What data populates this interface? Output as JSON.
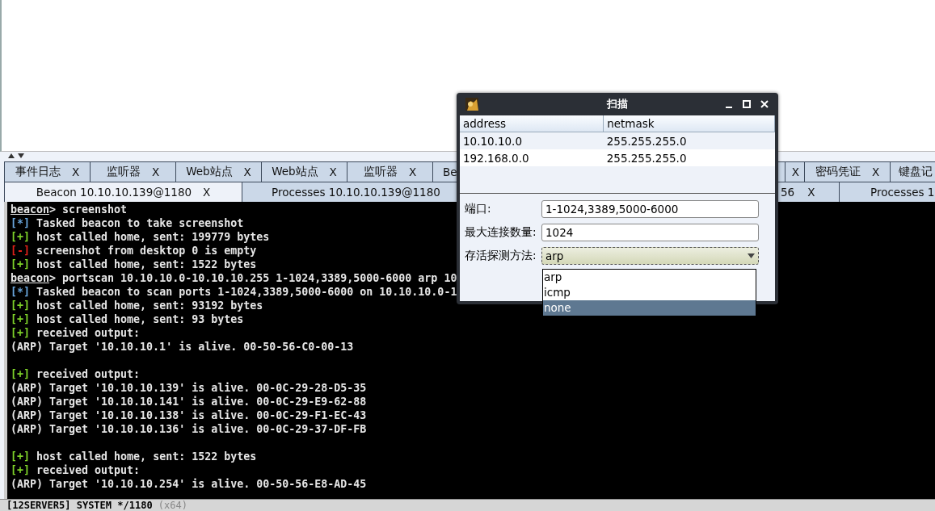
{
  "tab_rows": [
    [
      {
        "label": "事件日志",
        "close": "X",
        "selected": false
      },
      {
        "label": "监听器",
        "close": "X",
        "selected": false
      },
      {
        "label": "Web站点",
        "close": "X",
        "selected": false
      },
      {
        "label": "Web站点",
        "close": "X",
        "selected": false
      },
      {
        "label": "监听器",
        "close": "X",
        "selected": false
      },
      {
        "label": "Be",
        "selected": false,
        "kind": "covered"
      },
      {
        "close": "X",
        "selected": false
      },
      {
        "label": "密码凭证",
        "close": "X",
        "selected": false
      },
      {
        "label": "键盘记",
        "selected": false,
        "kind": "edge"
      }
    ],
    [
      {
        "label": "Beacon 10.10.10.139@1180",
        "close": "X",
        "selected": true
      },
      {
        "label": "Processes 10.10.10.139@1180",
        "selected": false,
        "kind": "covered"
      },
      {
        "label": "56",
        "close": "X",
        "selected": false
      },
      {
        "label": "Processes 1",
        "selected": false,
        "kind": "edge"
      }
    ]
  ],
  "console": {
    "lines": [
      {
        "kind": "prompt",
        "prompt": "beacon",
        "text": "> screenshot"
      },
      {
        "kind": "tagged",
        "tag": "[*]",
        "color": "#6aa7df",
        "text": " Tasked beacon to take screenshot"
      },
      {
        "kind": "tagged",
        "tag": "[+]",
        "color": "#7fd32a",
        "text": " host called home, sent: 199779 bytes"
      },
      {
        "kind": "tagged",
        "tag": "[-]",
        "color": "#e0201a",
        "text": " screenshot from desktop 0 is empty"
      },
      {
        "kind": "tagged",
        "tag": "[+]",
        "color": "#7fd32a",
        "text": " host called home, sent: 1522 bytes"
      },
      {
        "kind": "prompt",
        "prompt": "beacon",
        "text": "> portscan 10.10.10.0-10.10.10.255 1-1024,3389,5000-6000 arp 10"
      },
      {
        "kind": "tagged",
        "tag": "[*]",
        "color": "#6aa7df",
        "text": " Tasked beacon to scan ports 1-1024,3389,5000-6000 on 10.10.10.0-1"
      },
      {
        "kind": "tagged",
        "tag": "[+]",
        "color": "#7fd32a",
        "text": " host called home, sent: 93192 bytes"
      },
      {
        "kind": "tagged",
        "tag": "[+]",
        "color": "#7fd32a",
        "text": " host called home, sent: 93 bytes"
      },
      {
        "kind": "tagged",
        "tag": "[+]",
        "color": "#7fd32a",
        "text": " received output:"
      },
      {
        "kind": "plain",
        "text": "(ARP) Target '10.10.10.1' is alive. 00-50-56-C0-00-13"
      },
      {
        "kind": "blank"
      },
      {
        "kind": "tagged",
        "tag": "[+]",
        "color": "#7fd32a",
        "text": " received output:"
      },
      {
        "kind": "plain",
        "text": "(ARP) Target '10.10.10.139' is alive. 00-0C-29-28-D5-35"
      },
      {
        "kind": "plain",
        "text": "(ARP) Target '10.10.10.141' is alive. 00-0C-29-E9-62-88"
      },
      {
        "kind": "plain",
        "text": "(ARP) Target '10.10.10.138' is alive. 00-0C-29-F1-EC-43"
      },
      {
        "kind": "plain",
        "text": "(ARP) Target '10.10.10.136' is alive. 00-0C-29-37-DF-FB"
      },
      {
        "kind": "blank"
      },
      {
        "kind": "tagged",
        "tag": "[+]",
        "color": "#7fd32a",
        "text": " host called home, sent: 1522 bytes"
      },
      {
        "kind": "tagged",
        "tag": "[+]",
        "color": "#7fd32a",
        "text": " received output:"
      },
      {
        "kind": "plain",
        "text": "(ARP) Target '10.10.10.254' is alive. 00-50-56-E8-AD-45"
      }
    ]
  },
  "status_bar": {
    "text": "[12SERVER5] SYSTEM */1180",
    "arch": "(x64)"
  },
  "dialog": {
    "title": "扫描",
    "table": {
      "columns": [
        "address",
        "netmask"
      ],
      "rows": [
        [
          "10.10.10.0",
          "255.255.255.0"
        ],
        [
          "192.168.0.0",
          "255.255.255.0"
        ]
      ]
    },
    "fields": [
      {
        "kind": "text",
        "label": "端口:",
        "value": "1-1024,3389,5000-6000"
      },
      {
        "kind": "text",
        "label": "最大连接数量:",
        "value": "1024"
      },
      {
        "kind": "combo",
        "label": "存活探测方法:",
        "value": "arp",
        "expanded": true,
        "options": [
          {
            "label": "arp",
            "highlighted": false
          },
          {
            "label": "icmp",
            "highlighted": false
          },
          {
            "label": "none",
            "highlighted": true
          }
        ]
      }
    ]
  }
}
